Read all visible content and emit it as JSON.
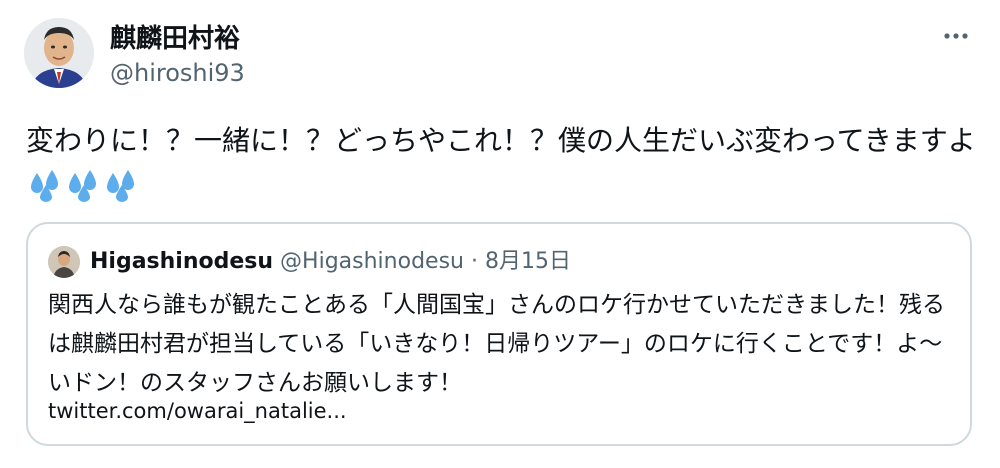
{
  "author": {
    "display_name": "麒麟田村裕",
    "handle": "@hiroshi93"
  },
  "tweet": {
    "text": "変わりに！？一緒に！？どっちやこれ！？僕の人生だいぶ変わってきますよ",
    "emoji_icons": [
      "sweat-droplets-icon",
      "sweat-droplets-icon",
      "sweat-droplets-icon"
    ]
  },
  "quoted_tweet": {
    "display_name": "Higashinodesu",
    "handle": "@Higashinodesu",
    "separator": "·",
    "date": "8月15日",
    "text": "関西人なら誰もが観たことある「人間国宝」さんのロケ行かせていただきました！残るは麒麟田村君が担当している「いきなり！日帰りツアー」のロケに行くことです！よ〜いドン！のスタッフさんお願いします！",
    "link": "twitter.com/owarai_natalie..."
  },
  "colors": {
    "primary_text": "#0f1419",
    "secondary_text": "#536471",
    "border": "#cfd9de",
    "emoji_blue": "#5dadec"
  }
}
